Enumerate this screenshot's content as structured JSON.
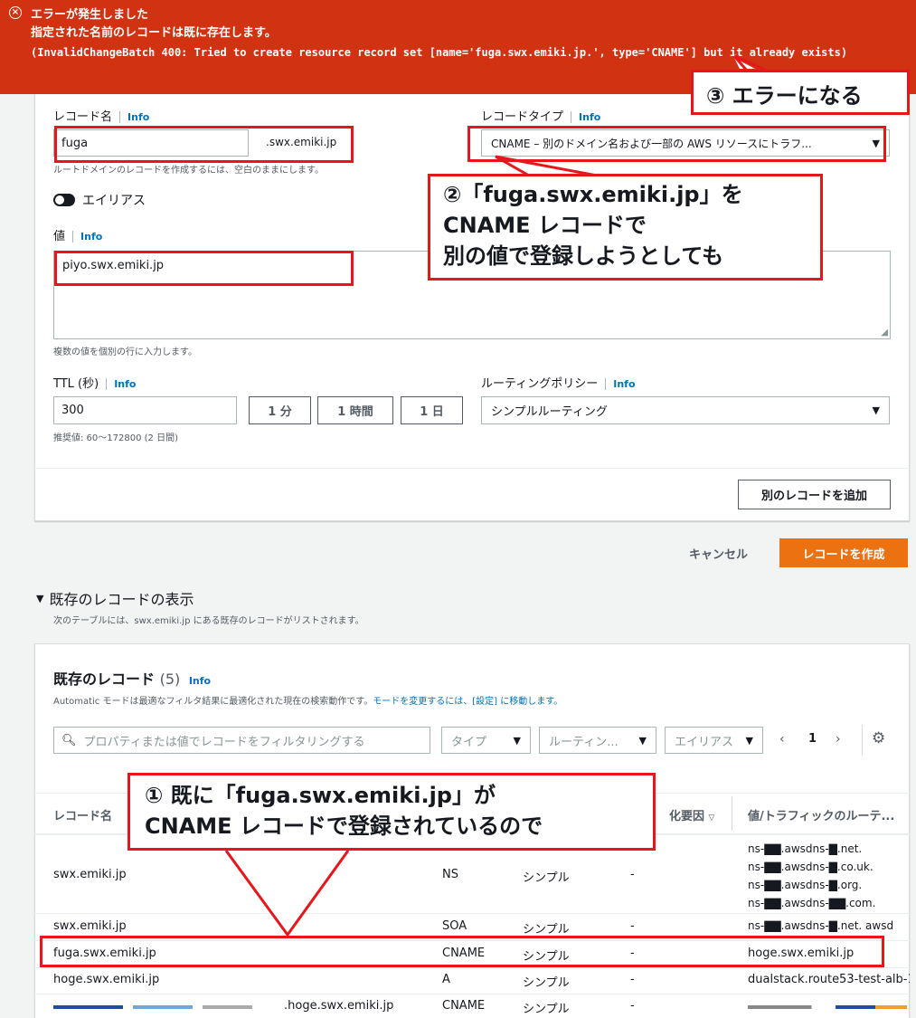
{
  "banner": {
    "title": "エラーが発生しました",
    "message": "指定された名前のレコードは既に存在します。",
    "detail": "(InvalidChangeBatch 400: Tried to create resource record set [name='fuga.swx.emiki.jp.', type='CNAME'] but it already exists)"
  },
  "form": {
    "record_name_label": "レコード名",
    "info": "Info",
    "record_name_value": "fuga",
    "domain_suffix": ".swx.emiki.jp",
    "record_name_hint": "ルートドメインのレコードを作成するには、空白のままにします。",
    "record_type_label": "レコードタイプ",
    "record_type_value": "CNAME – 別のドメイン名および一部の AWS リソースにトラフ...",
    "alias_label": "エイリアス",
    "value_label": "値",
    "value_text": "piyo.swx.emiki.jp",
    "value_hint": "複数の値を個別の行に入力します。",
    "ttl_label": "TTL (秒)",
    "ttl_value": "300",
    "ttl_1m": "1 分",
    "ttl_1h": "1 時間",
    "ttl_1d": "1 日",
    "ttl_hint": "推奨値: 60～172800 (2 日間)",
    "routing_label": "ルーティングポリシー",
    "routing_value": "シンプルルーティング",
    "add_record": "別のレコードを追加"
  },
  "actions": {
    "cancel": "キャンセル",
    "create": "レコードを作成"
  },
  "existing": {
    "section_title": "既存のレコードの表示",
    "section_desc": "次のテーブルには、swx.emiki.jp にある既存のレコードがリストされます。",
    "table_title": "既存のレコード",
    "count": "(5)",
    "automatic_note": "Automatic モードは最適なフィルタ結果に最適化された現在の検索動作です。",
    "automatic_link": "モードを変更するには、[設定] に移動します。",
    "filter_placeholder": "プロパティまたは値でレコードをフィルタリングする",
    "filter_type": "タイプ",
    "filter_routing": "ルーティン...",
    "filter_alias": "エイリアス",
    "page": "1",
    "headers": [
      "レコード名",
      "化要因",
      "値/トラフィックのルーテ..."
    ],
    "rows": [
      {
        "name": "swx.emiki.jp",
        "type": "NS",
        "policy": "シンプル",
        "diff": "-",
        "values": [
          "ns-▇▇.awsdns-▇.net.",
          "ns-▇▇.awsdns-▇.co.uk.",
          "ns-▇▇.awsdns-▇.org.",
          "ns-▇▇.awsdns-▇▇.com."
        ]
      },
      {
        "name": "swx.emiki.jp",
        "type": "SOA",
        "policy": "シンプル",
        "diff": "-",
        "values": [
          "ns-▇▇.awsdns-▇.net. awsd"
        ]
      },
      {
        "name": "fuga.swx.emiki.jp",
        "type": "CNAME",
        "policy": "シンプル",
        "diff": "-",
        "values": [
          "hoge.swx.emiki.jp"
        ]
      },
      {
        "name": "hoge.swx.emiki.jp",
        "type": "A",
        "policy": "シンプル",
        "diff": "-",
        "values": [
          "dualstack.route53-test-alb-1"
        ]
      },
      {
        "name": ".hoge.swx.emiki.jp",
        "type": "CNAME",
        "policy": "シンプル",
        "diff": "-",
        "values": [
          ""
        ]
      }
    ]
  },
  "annotations": {
    "c3": "③ エラーになる",
    "c2_l1": "②「fuga.swx.emiki.jp」を",
    "c2_l2": "CNAME レコードで",
    "c2_l3": "別の値で登録しようとしても",
    "c1_l1": "① 既に「fuga.swx.emiki.jp」が",
    "c1_l2": "CNAME レコードで登録されているので"
  }
}
